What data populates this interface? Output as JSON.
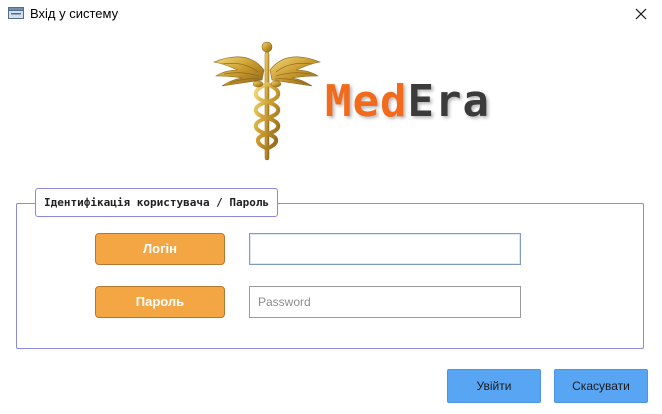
{
  "window": {
    "title": "Вхід у систему",
    "app_icon": "window-app-icon",
    "close_icon": "close-icon"
  },
  "branding": {
    "emblem": "caduceus-icon",
    "logo_part1": "Med",
    "logo_part2": "Era",
    "colors": {
      "med": "#f26a1b",
      "era": "#3b3b3b",
      "emblem_gold": "#c9a227"
    }
  },
  "form": {
    "group_title": "Ідентифікація користувача / Пароль",
    "login_label": "Логін",
    "password_label": "Пароль",
    "login_value": "",
    "password_placeholder": "Password"
  },
  "buttons": {
    "ok": "Увійти",
    "cancel": "Скасувати"
  },
  "colors": {
    "label_bg": "#f4a644",
    "button_bg": "#58a5f4",
    "group_border": "#8a8ad8"
  }
}
